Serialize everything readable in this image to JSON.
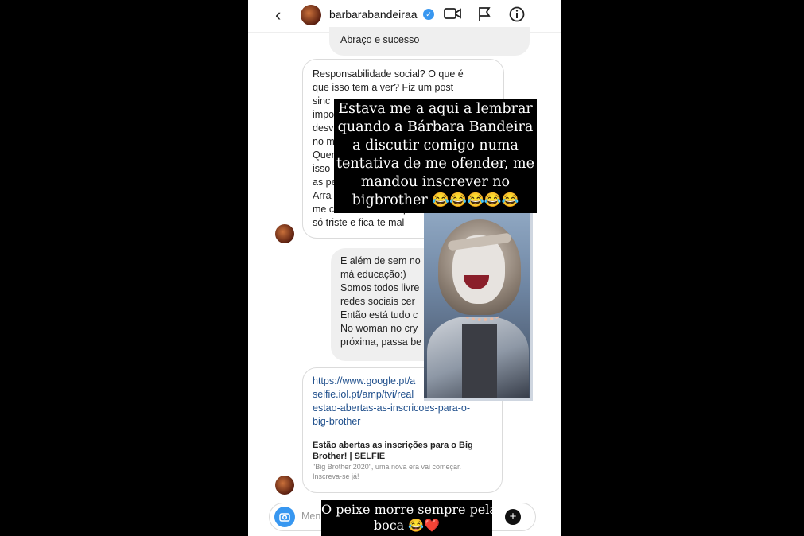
{
  "header": {
    "username": "barbarabandeiraa",
    "verified_badge": "✓",
    "back_icon": "chevron-left-icon",
    "icons": [
      "video-call-icon",
      "flag-icon",
      "info-icon"
    ]
  },
  "messages": {
    "sent_1": "Abraço e sucesso",
    "received_1_lines": [
      "Responsabilidade social? O que é",
      "que isso tem a ver? Fiz um post",
      "sinc",
      "impo",
      "desv",
      "no m",
      "Quer",
      "isso",
      "as pe",
      "Arra",
      "me conheces e vais pul",
      "só triste e fica-te mal"
    ],
    "sent_2_lines": [
      "E além de sem no",
      "má educação:)",
      "Somos todos livre",
      "redes sociais cer",
      "Então está tudo c",
      "No woman no cry",
      "próxima, passa be"
    ],
    "link_lines": [
      "https://www.google.pt/a",
      "selfie.iol.pt/amp/tvi/real",
      "estao-abertas-as-inscricoes-para-o-",
      "big-brother"
    ],
    "preview_title_lines": [
      "Estão abertas as inscrições para o Big",
      "Brother! | SELFIE"
    ],
    "preview_desc_lines": [
      "\"Big Brother 2020\", uma nova era vai começar.",
      "Inscreva-se já!"
    ]
  },
  "composer": {
    "placeholder": "Men",
    "camera_icon": "camera-icon",
    "plus_icon": "plus-icon"
  },
  "overlay": {
    "caption_top_lines": [
      "Estava me a aqui a lembrar",
      "quando a Bárbara Bandeira",
      "a discutir comigo numa",
      "tentativa de me ofender, me",
      "mandou inscrever no",
      "bigbrother 😂😂😂😂😂"
    ],
    "caption_bottom_lines": [
      "O peixe morre sempre pela",
      "boca 😂❤️"
    ]
  }
}
